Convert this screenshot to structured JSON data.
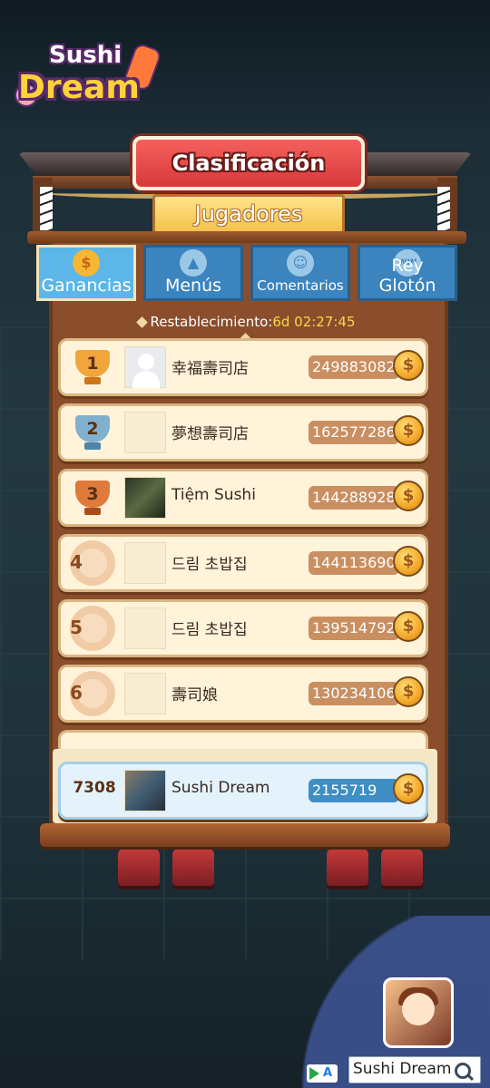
{
  "app": {
    "logo_line1": "Sushi",
    "logo_line2": "Dream"
  },
  "header": {
    "title": "Clasificación",
    "subtitle": "Jugadores"
  },
  "tabs": [
    {
      "label": "Ganancias",
      "icon": "coin-icon",
      "active": true
    },
    {
      "label": "Menús",
      "icon": "cloche-icon",
      "active": false
    },
    {
      "label": "Comentarios",
      "icon": "smiley-icon",
      "active": false
    },
    {
      "label": "Rey Glotón",
      "icon": "win-stopwatch-icon",
      "active": false
    }
  ],
  "reset": {
    "label": "Restablecimiento:",
    "time": "6d 02:27:45"
  },
  "rows": [
    {
      "rank": "1",
      "badge": "gold-trophy-icon",
      "avatar": "default-avatar",
      "name": "幸福壽司店",
      "score": "249883082"
    },
    {
      "rank": "2",
      "badge": "silver-trophy-icon",
      "avatar": "empty",
      "name": "夢想壽司店",
      "score": "162577286"
    },
    {
      "rank": "3",
      "badge": "bronze-trophy-icon",
      "avatar": "photo",
      "name": "Tiệm Sushi",
      "score": "144288928"
    },
    {
      "rank": "4",
      "badge": "flower-icon",
      "avatar": "empty",
      "name": "드림 초밥집",
      "score": "144113690"
    },
    {
      "rank": "5",
      "badge": "flower-icon",
      "avatar": "empty",
      "name": "드림 초밥집",
      "score": "139514792"
    },
    {
      "rank": "6",
      "badge": "flower-icon",
      "avatar": "empty",
      "name": "壽司娘",
      "score": "130234106"
    }
  ],
  "me": {
    "rank": "7308",
    "name": "Sushi Dream",
    "score": "2155719"
  },
  "coin_symbol": "$",
  "search": {
    "text": "Sushi Dream"
  },
  "colors": {
    "title_red": "#d7393b",
    "tab_blue": "#3b84be",
    "tab_active": "#5cb6e8",
    "row_bg": "#fff3da",
    "score_brown": "#c98f61",
    "me_score_blue": "#3f8ec4",
    "timer_yellow": "#ffd34a"
  }
}
